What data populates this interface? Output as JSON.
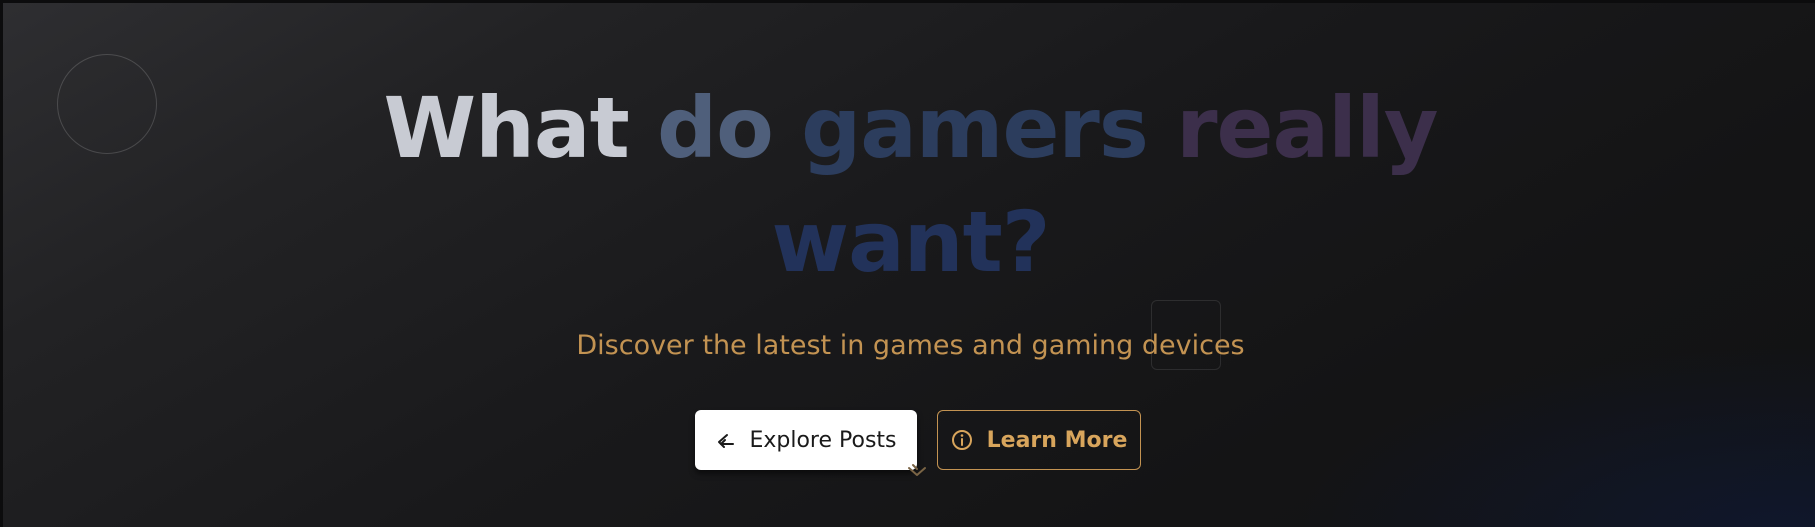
{
  "hero": {
    "headline": {
      "word_1": "What",
      "word_2": "do",
      "word_3": "gamers",
      "word_4": "really",
      "word_5": "want?"
    },
    "subtitle": "Discover the latest in games and gaming devices",
    "primary_button": {
      "label": "Explore Posts",
      "icon": "arrow-icon"
    },
    "secondary_button": {
      "label": "Learn More",
      "icon": "info-icon"
    },
    "scroll_indicator_icon": "chevron-down-icon"
  },
  "colors": {
    "background": "#141416",
    "accent_gold": "#c39352",
    "headline_light": "#c8cbd3",
    "headline_blue": "#2c3d5d",
    "headline_purple": "#3c2f4b",
    "button_primary_bg": "#ffffff"
  }
}
